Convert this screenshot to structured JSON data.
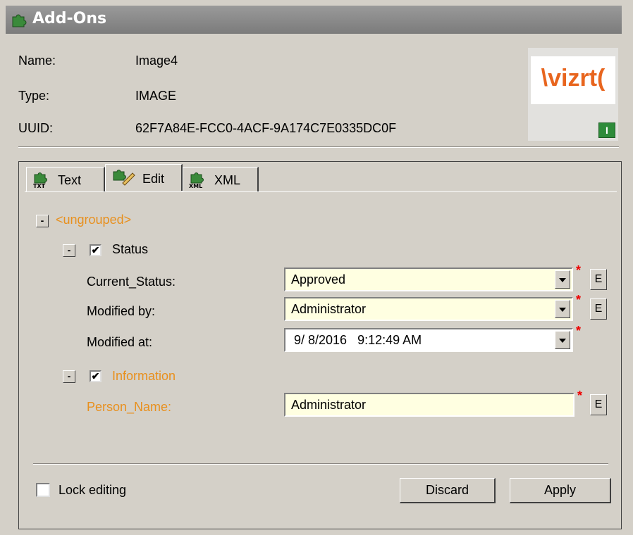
{
  "window": {
    "title": "Add-Ons"
  },
  "info": {
    "name_label": "Name:",
    "name_value": "Image4",
    "type_label": "Type:",
    "type_value": "IMAGE",
    "uuid_label": "UUID:",
    "uuid_value": "62F7A84E-FCC0-4ACF-9A174C7E0335DC0F"
  },
  "logo": {
    "text": "\\vizrt(",
    "badge": "I"
  },
  "tabs": [
    {
      "label": "Text",
      "icon": "txt-icon"
    },
    {
      "label": "Edit",
      "icon": "edit-icon",
      "active": true
    },
    {
      "label": "XML",
      "icon": "xml-icon"
    }
  ],
  "tree": {
    "root_label": "<ungrouped>",
    "status_group": "Status",
    "info_group": "Information",
    "collapse_symbol": "-",
    "check_symbol": "✔"
  },
  "fields": {
    "current_status_label": "Current_Status:",
    "current_status_value": "Approved",
    "modified_by_label": "Modified by:",
    "modified_by_value": "Administrator",
    "modified_at_label": "Modified at:",
    "modified_at_value": "9/ 8/2016   9:12:49 AM",
    "person_name_label": "Person_Name:",
    "person_name_value": "Administrator",
    "required_mark": "*",
    "edit_button": "E"
  },
  "footer": {
    "lock_label": "Lock editing",
    "discard_label": "Discard",
    "apply_label": "Apply"
  },
  "colors": {
    "accent_orange": "#e8901e",
    "required_red": "#ee0000",
    "field_bg": "#ffffe1"
  }
}
